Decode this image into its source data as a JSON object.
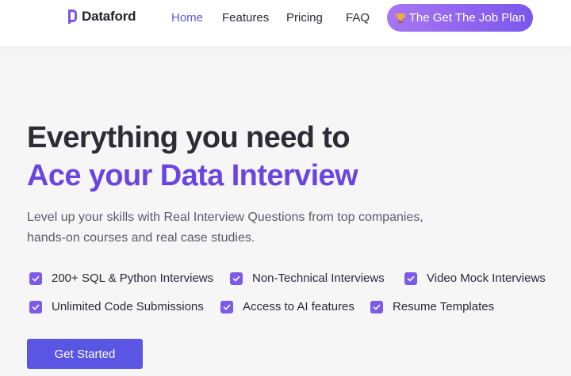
{
  "header": {
    "logo_text": "Dataford",
    "nav": {
      "home": "Home",
      "features": "Features",
      "pricing": "Pricing",
      "faq": "FAQ"
    },
    "cta_label": "The Get The Job Plan",
    "cta_icon": "trophy-icon"
  },
  "hero": {
    "title_line1": "Everything you need to",
    "title_line2": "Ace your Data Interview",
    "subtitle_line1": "Level up your skills with Real Interview Questions from top companies,",
    "subtitle_line2": "hands-on courses and real case studies.",
    "features": [
      "200+ SQL & Python Interviews",
      "Non-Technical Interviews",
      "Video Mock Interviews",
      "Unlimited Code Submissions",
      "Access to AI features",
      "Resume Templates"
    ],
    "button_label": "Get Started"
  },
  "colors": {
    "accent": "#6a45e0",
    "nav_active": "#5d56d6",
    "button": "#5a55e3",
    "checkbox": "#7b5be8"
  }
}
